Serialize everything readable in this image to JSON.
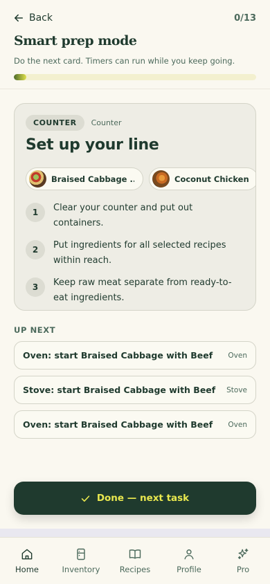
{
  "header": {
    "back_label": "Back",
    "step_counter": "0/13",
    "title": "Smart prep mode",
    "subtitle": "Do the next card. Timers can run while you keep going.",
    "progress": 0.05
  },
  "current_card": {
    "badge": "COUNTER",
    "station": "Counter",
    "title": "Set up your line",
    "recipes": [
      {
        "label": "Braised Cabbage ...",
        "icon": "braised-cabbage-thumbnail"
      },
      {
        "label": "Coconut Chicken",
        "icon": "coconut-chicken-thumbnail"
      }
    ],
    "steps": [
      {
        "num": "1",
        "text": "Clear your counter and put out containers."
      },
      {
        "num": "2",
        "text": "Put ingredients for all selected recipes within reach."
      },
      {
        "num": "3",
        "text": "Keep raw meat separate from ready-to-eat ingredients."
      }
    ]
  },
  "up_next": {
    "heading": "UP NEXT",
    "tasks": [
      {
        "title": "Oven: start Braised Cabbage with Beef",
        "tag": "Oven"
      },
      {
        "title": "Stove: start Braised Cabbage with Beef",
        "tag": "Stove"
      },
      {
        "title": "Oven: start Braised Cabbage with Beef",
        "tag": "Oven"
      }
    ]
  },
  "cta": {
    "label": "Done — next task",
    "icon": "check-icon"
  },
  "tabs": [
    {
      "label": "Home",
      "icon": "home-icon",
      "active": true
    },
    {
      "label": "Inventory",
      "icon": "inventory-icon",
      "active": false
    },
    {
      "label": "Recipes",
      "icon": "book-icon",
      "active": false
    },
    {
      "label": "Profile",
      "icon": "user-icon",
      "active": false
    },
    {
      "label": "Pro",
      "icon": "sparkle-icon",
      "active": false
    }
  ],
  "colors": {
    "primary": "#1f3a2e",
    "accent": "#e9e84f",
    "background": "#faf8f0",
    "card": "#eeede5"
  }
}
